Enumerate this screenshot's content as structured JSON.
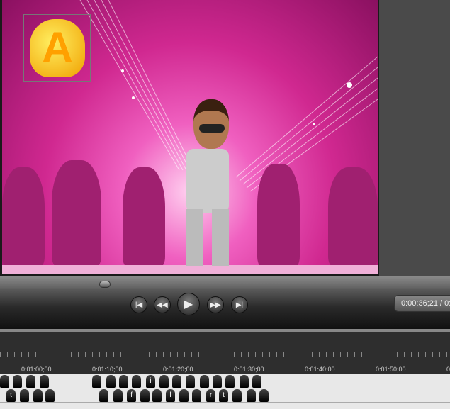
{
  "player": {
    "current_time": "0:00:36;21 / 0:",
    "scrub_fraction": 0.23
  },
  "controls": [
    {
      "name": "skip-back-button",
      "glyph": "|◀"
    },
    {
      "name": "rewind-button",
      "glyph": "◀◀"
    },
    {
      "name": "play-button",
      "glyph": "▶"
    },
    {
      "name": "fast-forward-button",
      "glyph": "▶▶"
    },
    {
      "name": "skip-forward-button",
      "glyph": "▶|"
    }
  ],
  "timeline": {
    "labels": [
      "0:01:00;00",
      "0:01:10;00",
      "0:01:20;00",
      "0:01:30;00",
      "0:01:40;00",
      "0:01:50;00",
      "0"
    ],
    "track1": [
      "",
      "",
      "",
      "",
      "",
      "",
      "",
      "",
      "i",
      "",
      "",
      "",
      "",
      "",
      "",
      "",
      ""
    ],
    "track2": [
      "t",
      "",
      "",
      "",
      "",
      "",
      "f",
      "",
      "",
      "l",
      "",
      "",
      "r",
      "t",
      "",
      "",
      ""
    ]
  },
  "colors": {
    "background": "#e040b0",
    "caption": "#ffcc00"
  }
}
